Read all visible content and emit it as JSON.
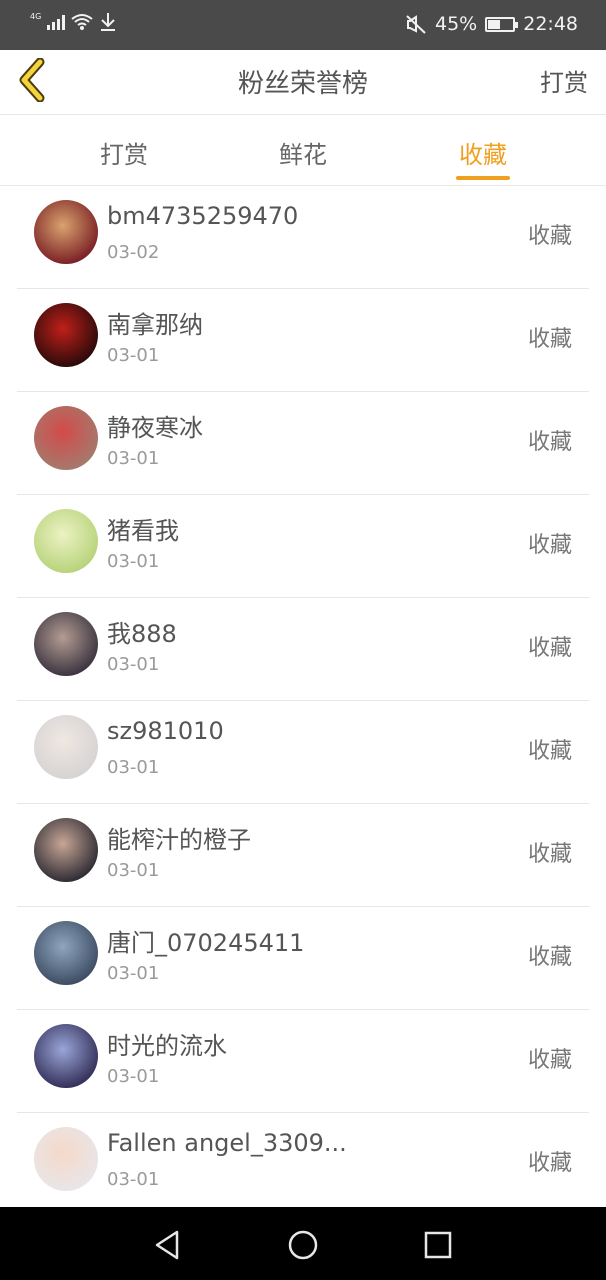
{
  "status_bar": {
    "network": "4G",
    "battery_percent": "45%",
    "battery_level": 0.45,
    "time": "22:48"
  },
  "header": {
    "title": "粉丝荣誉榜",
    "action_label": "打赏"
  },
  "tabs": [
    {
      "label": "打赏"
    },
    {
      "label": "鲜花"
    },
    {
      "label": "收藏"
    }
  ],
  "active_tab": "收藏",
  "colors": {
    "accent": "#f0a020",
    "status_bar_bg": "#4a4a4a",
    "nav_bar_bg": "#000000"
  },
  "list": [
    {
      "name": "bm4735259470",
      "date": "03-02",
      "tag": "收藏",
      "avatar_palette": [
        "#7a1f25",
        "#d9a36f"
      ]
    },
    {
      "name": "南拿那纳",
      "date": "03-01",
      "tag": "收藏",
      "avatar_palette": [
        "#2a0a0a",
        "#c0201a"
      ]
    },
    {
      "name": "静夜寒冰",
      "date": "03-01",
      "tag": "收藏",
      "avatar_palette": [
        "#a47a6c",
        "#d44a4a"
      ]
    },
    {
      "name": "猪看我",
      "date": "03-01",
      "tag": "收藏",
      "avatar_palette": [
        "#b7d37a",
        "#ecf2c4"
      ]
    },
    {
      "name": "我888",
      "date": "03-01",
      "tag": "收藏",
      "avatar_palette": [
        "#3b3340",
        "#b39d92"
      ]
    },
    {
      "name": "sz981010",
      "date": "03-01",
      "tag": "收藏",
      "avatar_palette": [
        "#d6d3d3",
        "#efe8e2"
      ]
    },
    {
      "name": "能榨汁的橙子",
      "date": "03-01",
      "tag": "收藏",
      "avatar_palette": [
        "#2e2b34",
        "#c7a695"
      ]
    },
    {
      "name": "唐门_070245411",
      "date": "03-01",
      "tag": "收藏",
      "avatar_palette": [
        "#3c4c62",
        "#8fa6bf"
      ]
    },
    {
      "name": "时光的流水",
      "date": "03-01",
      "tag": "收藏",
      "avatar_palette": [
        "#332e58",
        "#9aa7d8"
      ]
    },
    {
      "name": "Fallen angel_3309...",
      "date": "03-01",
      "tag": "收藏",
      "avatar_palette": [
        "#e9e5e8",
        "#f5d9c9"
      ]
    }
  ]
}
